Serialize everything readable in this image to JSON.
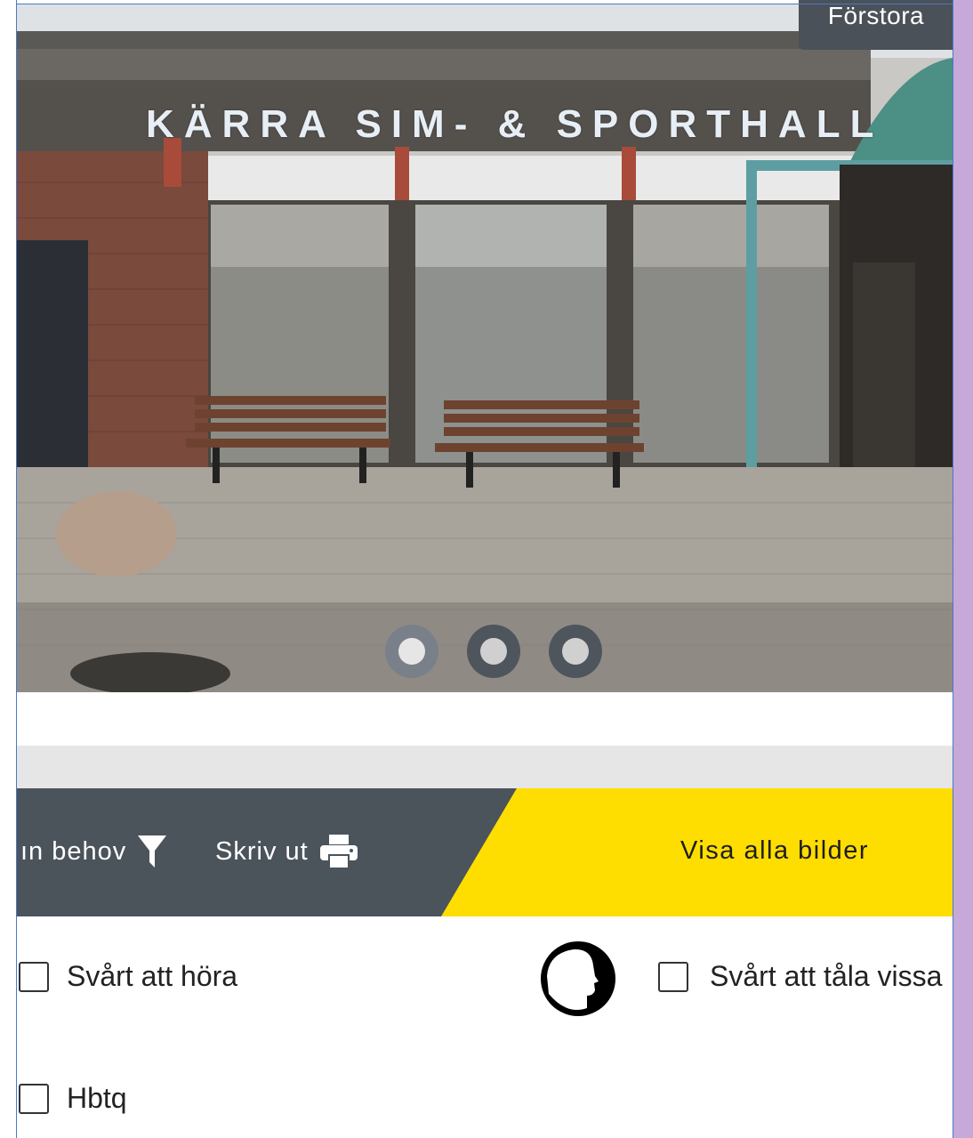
{
  "photo": {
    "sign_text": "KÄRRA SIM- & SPORTHALL",
    "enlarge_label": "Förstora",
    "carousel": {
      "count": 3,
      "active_index": 0
    }
  },
  "toolbar": {
    "filter_label": "ın behov",
    "print_label": "Skriv ut",
    "show_all_label": "Visa alla bilder"
  },
  "needs": {
    "hard_of_hearing": "Svårt att höra",
    "sensitive": "Svårt att tåla vissa",
    "hbtq": "Hbtq"
  },
  "colors": {
    "toolbar_dark": "#4b535b",
    "accent_yellow": "#fedd00",
    "right_band": "#c6a9d8"
  }
}
